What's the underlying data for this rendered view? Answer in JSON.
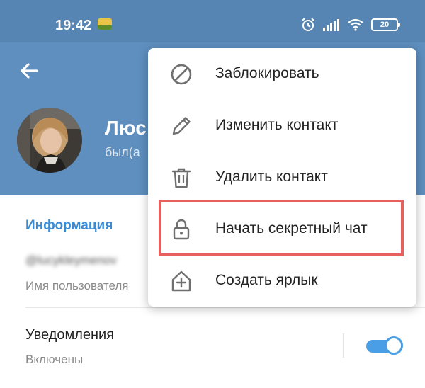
{
  "status_bar": {
    "time": "19:42",
    "battery": "20"
  },
  "profile": {
    "name": "Люс",
    "status": "был(а"
  },
  "info": {
    "section_title": "Информация",
    "username": "@lucykleymenov",
    "username_label": "Имя пользователя",
    "notifications_label": "Уведомления",
    "notifications_value": "Включены",
    "notifications_enabled": true
  },
  "menu": {
    "items": [
      {
        "label": "Заблокировать",
        "icon": "block-icon"
      },
      {
        "label": "Изменить контакт",
        "icon": "pencil-icon"
      },
      {
        "label": "Удалить контакт",
        "icon": "trash-icon"
      },
      {
        "label": "Начать секретный чат",
        "icon": "lock-icon",
        "highlighted": true
      },
      {
        "label": "Создать ярлык",
        "icon": "add-shortcut-icon"
      }
    ]
  },
  "colors": {
    "header": "#5e8fbf",
    "accent": "#3a8bd6",
    "highlight": "#e8605e"
  }
}
